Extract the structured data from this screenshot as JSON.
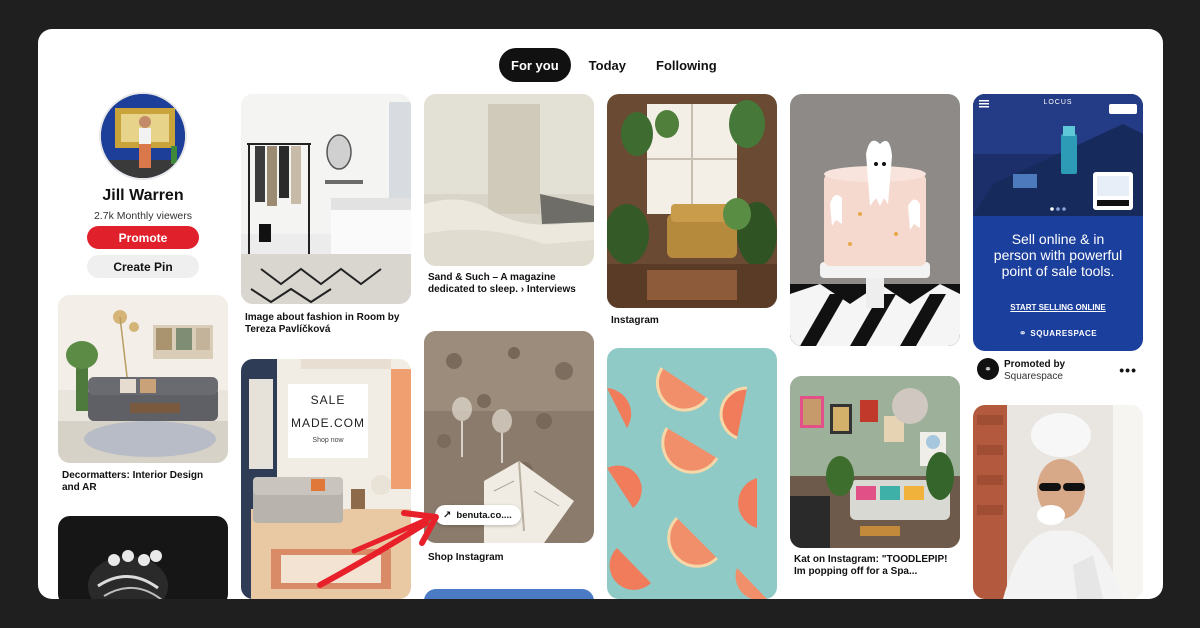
{
  "tabs": [
    {
      "label": "For you",
      "active": true
    },
    {
      "label": "Today",
      "active": false
    },
    {
      "label": "Following",
      "active": false
    }
  ],
  "profile": {
    "name": "Jill Warren",
    "viewers": "2.7k Monthly viewers",
    "promote_label": "Promote",
    "create_pin_label": "Create Pin"
  },
  "pins": {
    "decormatters": {
      "title": "Decormatters: Interior Design and AR"
    },
    "fashion_room": {
      "title": "Image about fashion in Room by Tereza Pavlíčková"
    },
    "sale_made": {
      "line1": "SALE",
      "line2": "MADE.COM",
      "line3": "Shop now"
    },
    "sand_such": {
      "title": "Sand & Such – A magazine dedicated to sleep. › Interviews"
    },
    "shop_instagram": {
      "title": "Shop Instagram",
      "url_label": "benuta.co...."
    },
    "instagram": {
      "title": "Instagram"
    },
    "kat": {
      "title": "Kat on Instagram: \"TOODLEPIP! Im popping off for a Spa..."
    },
    "squarespace_ad": {
      "brand_top": "LOCUS",
      "headline": "Sell online & in person with powerful point of sale tools.",
      "cta": "START SELLING ONLINE",
      "logo_text": "SQUARESPACE",
      "promoted_label": "Promoted by",
      "promoted_brand": "Squarespace",
      "more": "•••"
    }
  },
  "colors": {
    "promote": "#e0202a",
    "active_tab": "#111111",
    "annotation_arrow": "#e8202a",
    "ad_blue": "#1b3f9c"
  },
  "icons": {
    "url_pill": "arrow-up-right-icon",
    "promo_logo": "squarespace-logo-icon",
    "more": "more-icon",
    "annotation": "red-arrow-annotation"
  }
}
